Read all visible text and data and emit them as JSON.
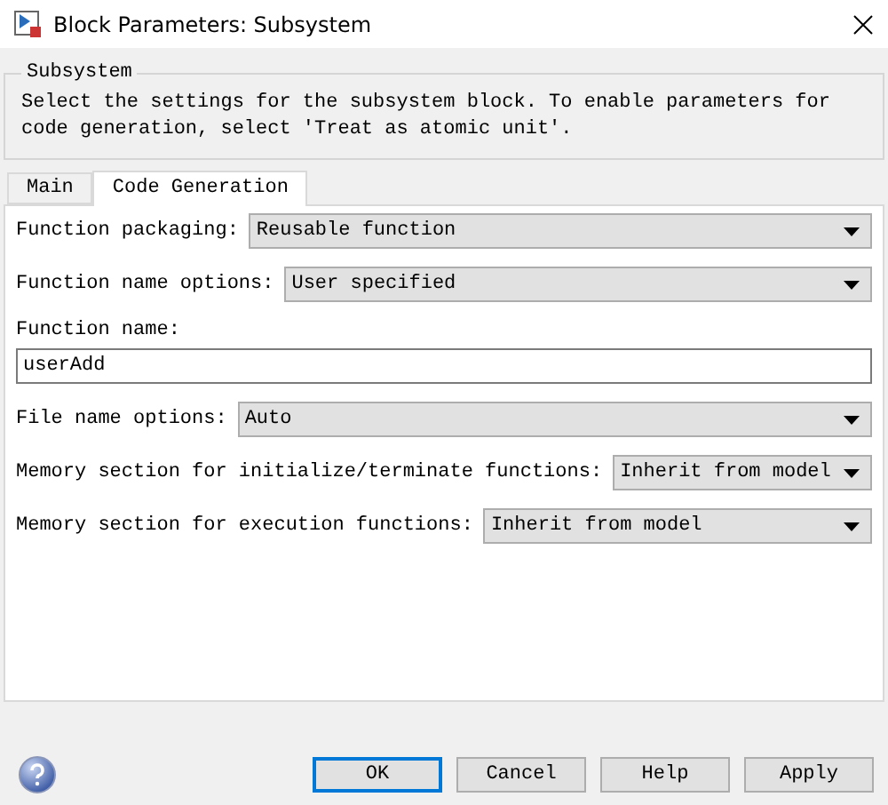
{
  "window": {
    "title": "Block Parameters: Subsystem"
  },
  "group": {
    "legend": "Subsystem",
    "description": "Select the settings for the subsystem block. To enable parameters for code generation, select 'Treat as atomic unit'."
  },
  "tabs": [
    {
      "label": "Main",
      "selected": false
    },
    {
      "label": "Code Generation",
      "selected": true
    }
  ],
  "fields": [
    {
      "kind": "dropdown",
      "label": "Function packaging:",
      "value": "Reusable function"
    },
    {
      "kind": "dropdown",
      "label": "Function name options:",
      "value": "User specified"
    },
    {
      "kind": "text",
      "label": "Function name:",
      "value": "userAdd"
    },
    {
      "kind": "dropdown",
      "label": "File name options:",
      "value": "Auto"
    },
    {
      "kind": "dropdown",
      "label": "Memory section for initialize/terminate functions:",
      "value": "Inherit from model"
    },
    {
      "kind": "dropdown",
      "label": "Memory section for execution functions:",
      "value": "Inherit from model"
    }
  ],
  "buttons": [
    {
      "label": "OK",
      "focused": true
    },
    {
      "label": "Cancel",
      "focused": false
    },
    {
      "label": "Help",
      "focused": false
    },
    {
      "label": "Apply",
      "focused": false
    }
  ]
}
